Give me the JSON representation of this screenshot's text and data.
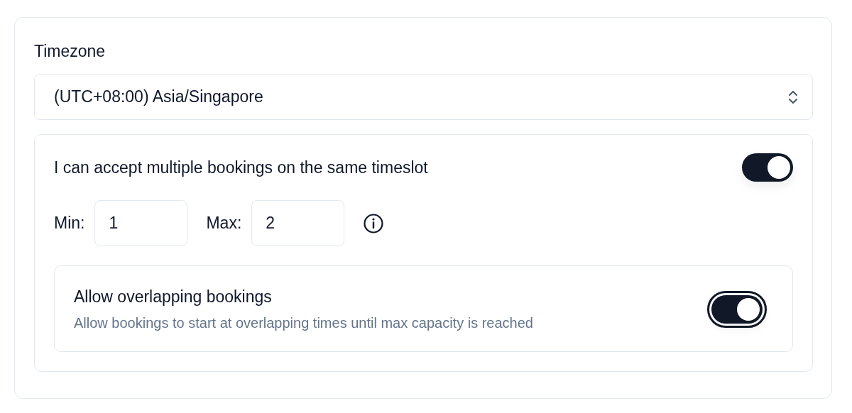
{
  "timezone": {
    "label": "Timezone",
    "value": "(UTC+08:00) Asia/Singapore"
  },
  "multiple_bookings": {
    "label": "I can accept multiple bookings on the same timeslot",
    "on": true,
    "min": {
      "label": "Min:",
      "value": "1"
    },
    "max": {
      "label": "Max:",
      "value": "2"
    },
    "overlapping": {
      "title": "Allow overlapping bookings",
      "description": "Allow bookings to start at overlapping times until max capacity is reached",
      "on": true,
      "focused": true
    }
  }
}
